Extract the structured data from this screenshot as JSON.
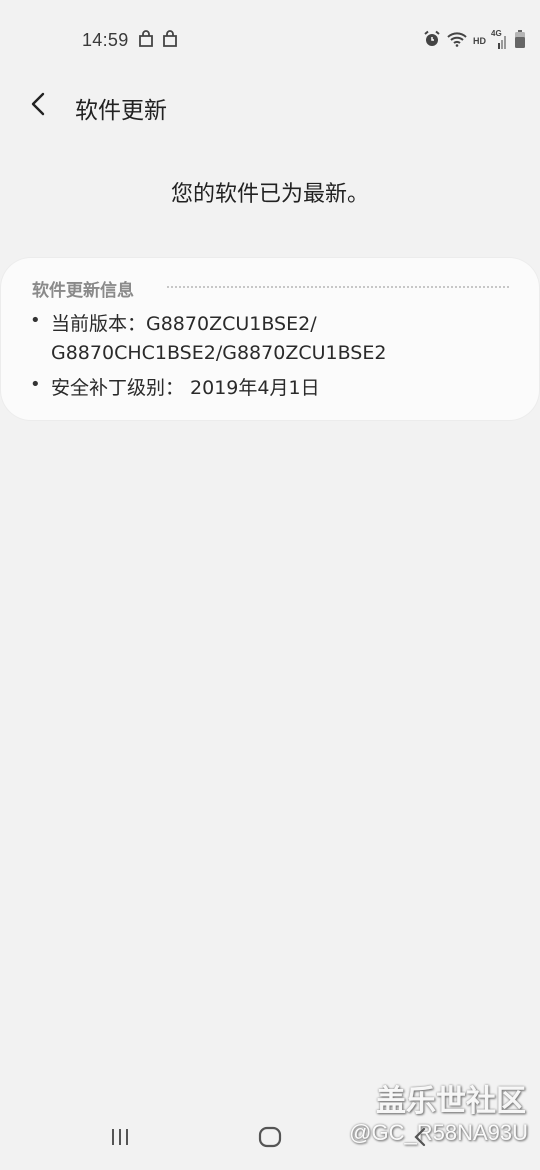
{
  "status": {
    "time": "14:59",
    "hd_label": "HD",
    "network_label": "4G"
  },
  "header": {
    "title": "软件更新"
  },
  "status_message": "您的软件已为最新。",
  "info_card": {
    "title": "软件更新信息",
    "items": [
      {
        "bullet": "•",
        "lines": [
          "当前版本：G8870ZCU1BSE2/",
          "G8870CHC1BSE2/G8870ZCU1BSE2"
        ]
      },
      {
        "bullet": "•",
        "lines": [
          "安全补丁级别： 2019年4月1日"
        ]
      }
    ]
  },
  "watermark": {
    "name": "盖乐世社区",
    "user": "@GC_R58NA93U"
  },
  "colors": {
    "background": "#f2f2f2",
    "card": "#fbfbfb",
    "card_title": "#8a8a8a"
  }
}
